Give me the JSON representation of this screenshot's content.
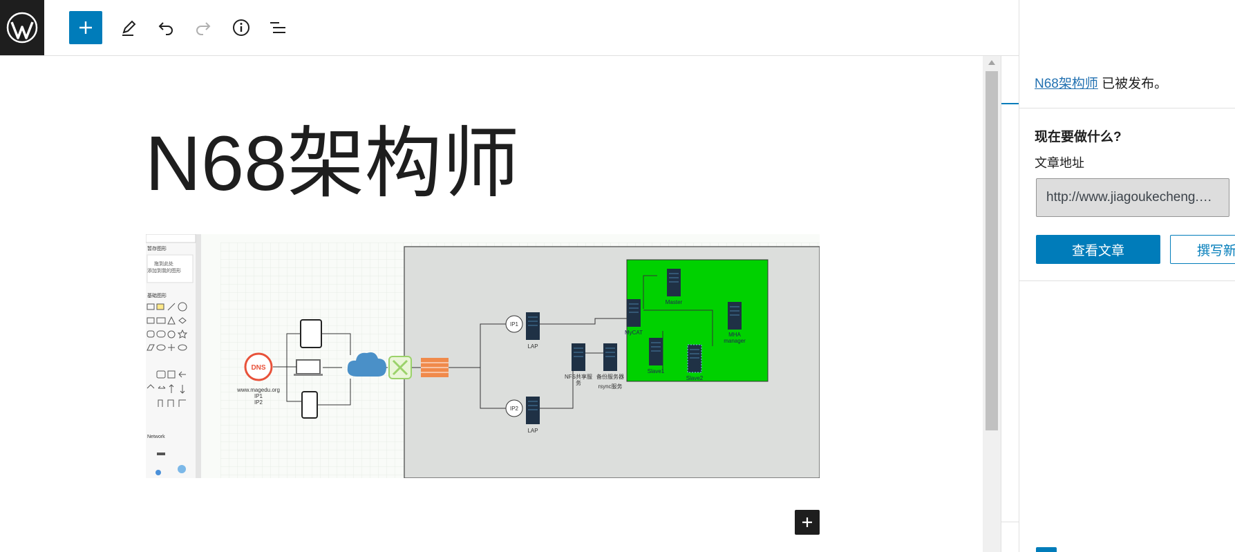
{
  "toolbar": {
    "logo_icon": "wordpress-logo-icon",
    "add_icon": "plus-icon",
    "tools_icon": "pencil-icon",
    "undo_icon": "undo-icon",
    "redo_icon": "redo-icon",
    "details_icon": "info-icon",
    "list_view_icon": "list-view-icon",
    "accent_color": "#007cba"
  },
  "editor": {
    "title": "N68架构师",
    "image": {
      "sidebar_search": "",
      "sidebar_scratchpad": "暂存图形",
      "scratchpad_hint_line1": "拖到此处",
      "scratchpad_hint_line2": "添加到我的图形",
      "section_basic": "基础图形",
      "section_network": "Network",
      "dns_label": "DNS",
      "domain_line1": "www.magedu.org",
      "domain_line2": "IP1",
      "domain_line3": "IP2",
      "ip1_label": "IP1",
      "ip2_label": "IP2",
      "lap1_label": "LAP",
      "lap2_label": "LAP",
      "nfs_line1": "NFS共享服",
      "nfs_line2": "务",
      "backup_line1": "备份服务器",
      "backup_line2": "rsync服务",
      "master_label": "Master",
      "mycat_label": "MyCAT",
      "slave1_label": "Slave1",
      "slave2_label": "Slave2",
      "mha_line1": "MHA",
      "mha_line2": "manager",
      "cluster_color": "#00d100"
    }
  },
  "panel": {
    "post_link": "N68架构师",
    "published_suffix": " 已被发布。",
    "whats_next": "现在要做什么?",
    "post_address_label": "文章地址",
    "post_url": "http://www.jiagoukecheng.…",
    "view_post_button": "查看文章",
    "new_post_button": "撰写新"
  }
}
